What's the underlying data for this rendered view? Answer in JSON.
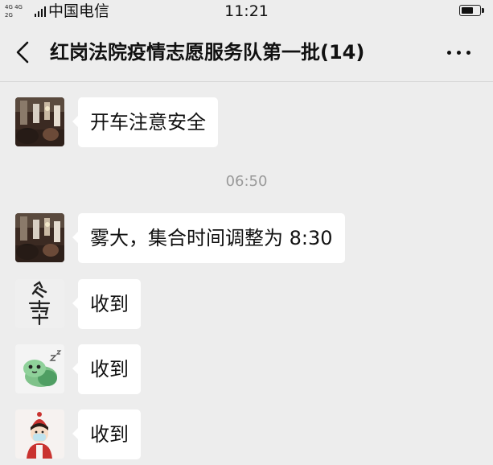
{
  "status_bar": {
    "network_top": "4G 4G",
    "network_bottom": "2G",
    "carrier": "中国电信",
    "time": "11:21",
    "battery_level": 0.7
  },
  "nav": {
    "back_icon": "chevron-left-icon",
    "title": "红岗法院疫情志愿服务队第一批(14)",
    "more_icon": "more-dots-icon"
  },
  "chat": {
    "timestamp": "06:50",
    "messages": [
      {
        "avatar": "photo-avatar-icon",
        "text": "开车注意安全"
      },
      {
        "avatar": "photo-avatar-icon",
        "text": "雾大，集合时间调整为 8:30"
      },
      {
        "avatar": "calligraphy-avatar-icon",
        "text": "收到"
      },
      {
        "avatar": "cartoon-frog-avatar-icon",
        "text": "收到"
      },
      {
        "avatar": "cartoon-girl-avatar-icon",
        "text": "收到"
      }
    ]
  },
  "colors": {
    "background": "#ededed",
    "bubble": "#ffffff",
    "timestamp_text": "#9a9a9a"
  }
}
